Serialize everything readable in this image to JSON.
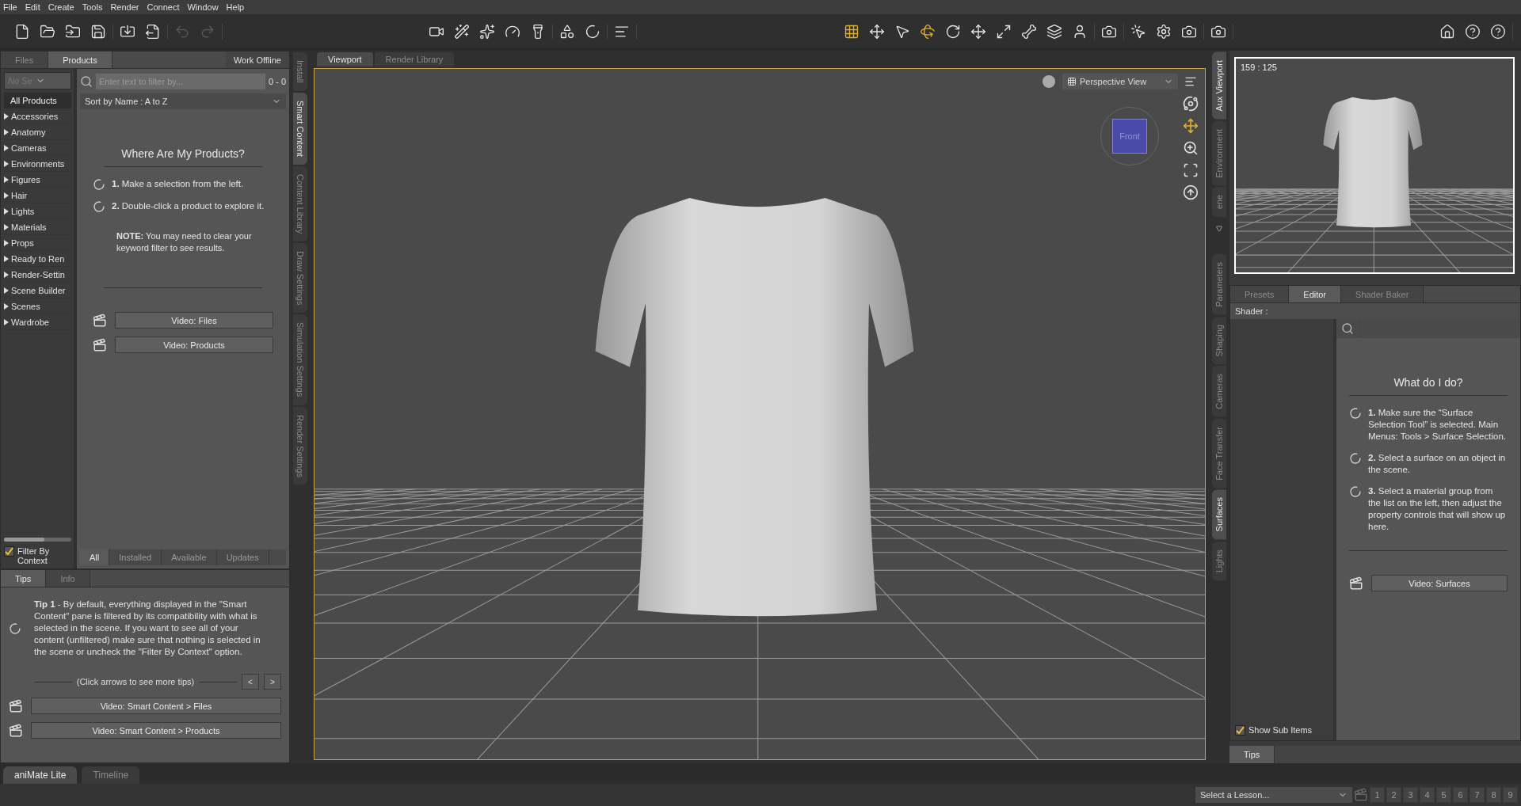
{
  "menu": [
    "File",
    "Edit",
    "Create",
    "Tools",
    "Render",
    "Connect",
    "Window",
    "Help"
  ],
  "left_tabs": [
    {
      "label": "Files",
      "selected": false
    },
    {
      "label": "Products",
      "selected": true
    }
  ],
  "work_offline": "Work Offline",
  "filter_dropdown": "No Se",
  "categories_header": "All Products",
  "categories": [
    "Accessories",
    "Anatomy",
    "Cameras",
    "Environments",
    "Figures",
    "Hair",
    "Lights",
    "Materials",
    "Props",
    "Ready to Ren",
    "Render-Settin",
    "Scene Builder",
    "Scenes",
    "Wardrobe"
  ],
  "size_slider": {
    "level": 0.6
  },
  "filter_by_context": {
    "label": "Filter By Context",
    "checked": true
  },
  "search": {
    "placeholder": "Enter text to filter by...",
    "count": "0 - 0"
  },
  "sort": "Sort by Name : A to Z",
  "products_help": {
    "title": "Where Are My Products?",
    "steps": [
      {
        "num": "1.",
        "text": "Make a selection from the left."
      },
      {
        "num": "2.",
        "text": "Double-click a product to explore it."
      }
    ],
    "note": "**NOTE:** You may need to clear your keyword filter to see results.",
    "videos": [
      "Video: Files",
      "Video: Products"
    ]
  },
  "product_filters": [
    {
      "label": "All",
      "selected": true
    },
    {
      "label": "Installed",
      "selected": false
    },
    {
      "label": "Available",
      "selected": false
    },
    {
      "label": "Updates",
      "selected": false
    }
  ],
  "tips_tabs": [
    {
      "label": "Tips",
      "selected": true
    },
    {
      "label": "Info",
      "selected": false
    }
  ],
  "tip": "**Tip 1** - By default, everything displayed in the \"Smart Content\" pane is filtered by its compatibility with what is selected in the scene. If you want to see all of your content (unfiltered) make sure that nothing is selected in the scene or uncheck the \"Filter By Context\" option.",
  "tips_hint": "(Click arrows to see more tips)",
  "tips_arrows": [
    "<",
    ">"
  ],
  "tips_videos": [
    "Video: Smart Content > Files",
    "Video: Smart Content > Products"
  ],
  "left_side_tabs": [
    {
      "label": "Install",
      "selected": false
    },
    {
      "label": "Smart Content",
      "selected": true
    },
    {
      "label": "Content Library",
      "selected": false
    },
    {
      "label": "Draw Settings",
      "selected": false
    },
    {
      "label": "Simulation Settings",
      "selected": false
    },
    {
      "label": "Render Settings",
      "selected": false
    }
  ],
  "viewport_tabs": [
    {
      "label": "Viewport",
      "selected": true
    },
    {
      "label": "Render Library",
      "selected": false
    }
  ],
  "view_dropdown": "Perspective View",
  "nav_cube": "Front",
  "right_top_tabs": [
    {
      "label": "Aux Viewport",
      "selected": true
    },
    {
      "label": "Environment",
      "selected": false
    },
    {
      "label": "ene",
      "selected": false
    }
  ],
  "aux_viewport": {
    "size": "159 : 125"
  },
  "right_bottom_tabs": [
    {
      "label": "Parameters",
      "selected": false
    },
    {
      "label": "Shaping",
      "selected": false
    },
    {
      "label": "Cameras",
      "selected": false
    },
    {
      "label": "Face Transfer",
      "selected": false
    },
    {
      "label": "Surfaces",
      "selected": true
    },
    {
      "label": "Lights",
      "selected": false
    }
  ],
  "surface_tabs": [
    {
      "label": "Presets",
      "selected": false
    },
    {
      "label": "Editor",
      "selected": true
    },
    {
      "label": "Shader Baker",
      "selected": false
    }
  ],
  "shader_label": "Shader :",
  "show_sub_items": {
    "label": "Show Sub Items",
    "checked": true
  },
  "surfaces_help": {
    "title": "What do I do?",
    "steps": [
      {
        "num": "1.",
        "text": "Make sure the “Surface Selection Tool” is selected. Main Menus: Tools > Surface Selection."
      },
      {
        "num": "2.",
        "text": "Select a surface on an object in the scene."
      },
      {
        "num": "3.",
        "text": "Select a material group from the list on the left, then adjust the property controls that will show up here."
      }
    ],
    "video": "Video: Surfaces"
  },
  "right_lower_tabs": [
    {
      "label": "Tips",
      "selected": true
    }
  ],
  "bottom_tabs": [
    {
      "label": "aniMate Lite",
      "selected": true
    },
    {
      "label": "Timeline",
      "selected": false
    }
  ],
  "lesson_select": "Select a Lesson...",
  "lesson_steps": [
    {
      "label": "1",
      "disabled": true
    },
    {
      "label": "2",
      "disabled": true
    },
    {
      "label": "3",
      "disabled": true
    },
    {
      "label": "4",
      "disabled": true
    },
    {
      "label": "5",
      "disabled": true
    },
    {
      "label": "6",
      "disabled": true
    },
    {
      "label": "7",
      "disabled": true
    },
    {
      "label": "8",
      "disabled": true
    },
    {
      "label": "9",
      "disabled": true
    }
  ]
}
